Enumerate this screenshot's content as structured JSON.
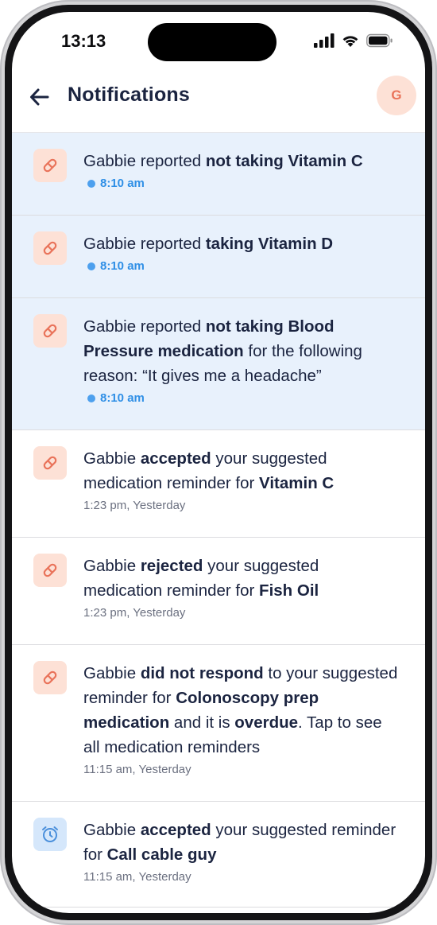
{
  "status_bar": {
    "time": "13:13"
  },
  "header": {
    "title": "Notifications",
    "avatar_initial": "G"
  },
  "colors": {
    "accent_blue": "#2f8fe6",
    "unread_bg": "#e8f1fc",
    "pill_icon": "#e9735a",
    "alarm_icon": "#4a8fdb"
  },
  "notifications": [
    {
      "unread": true,
      "icon": "pill-icon",
      "parts": [
        "Gabbie reported ",
        "not taking Vitamin C"
      ],
      "time": "8:10 am"
    },
    {
      "unread": true,
      "icon": "pill-icon",
      "parts": [
        "Gabbie reported ",
        "taking Vitamin D"
      ],
      "time": "8:10 am"
    },
    {
      "unread": true,
      "icon": "pill-icon",
      "parts": [
        "Gabbie reported ",
        "not taking Blood Pressure medication",
        " for the following reason: “It gives me a headache”"
      ],
      "time": "8:10 am"
    },
    {
      "unread": false,
      "icon": "pill-icon",
      "parts": [
        "Gabbie ",
        "accepted",
        " your suggested medication reminder for ",
        "Vitamin C"
      ],
      "time": "1:23 pm, Yesterday"
    },
    {
      "unread": false,
      "icon": "pill-icon",
      "parts": [
        "Gabbie ",
        "rejected",
        " your suggested medication reminder for ",
        "Fish Oil"
      ],
      "time": "1:23 pm, Yesterday"
    },
    {
      "unread": false,
      "icon": "pill-icon",
      "parts": [
        "Gabbie ",
        "did not respond",
        " to your suggested reminder for ",
        "Colonoscopy prep medication",
        " and it is ",
        "overdue",
        ". Tap to see all medication reminders"
      ],
      "time": "11:15 am, Yesterday"
    },
    {
      "unread": false,
      "icon": "alarm-icon",
      "parts": [
        "Gabbie ",
        "accepted",
        " your suggested reminder for ",
        "Call cable guy"
      ],
      "time": "11:15 am, Yesterday"
    }
  ]
}
